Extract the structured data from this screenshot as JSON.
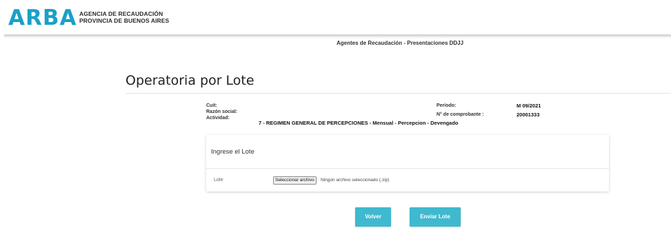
{
  "header": {
    "logo_text": "ARBA",
    "agency_line1": "AGENCIA DE RECAUDACIÓN",
    "agency_line2": "PROVINCIA DE BUENOS AIRES",
    "subtitle": "Agentes de Recaudación - Presentaciones DDJJ"
  },
  "page": {
    "title": "Operatoria por Lote"
  },
  "info": {
    "cuit_label": "Cuit:",
    "razon_label": "Razón social:",
    "actividad_label": "Actividad:",
    "actividad_value": "7 - REGIMEN GENERAL DE PERCEPCIONES - Mensual - Percepcion - Devengado",
    "periodo_label": "Período:",
    "periodo_value": "M 09/2021",
    "comprobante_label": "N° de comprobante :",
    "comprobante_value": "20001333"
  },
  "card": {
    "title": "Ingrese el Lote",
    "lote_label": "Lote",
    "file_button": "Seleccionar archivo",
    "file_status": "Ningún archivo seleccionado (.zip)"
  },
  "actions": {
    "volver": "Volver",
    "enviar": "Enviar Lote"
  },
  "colors": {
    "brand": "#1aa0c9",
    "button": "#3fb9cf"
  }
}
